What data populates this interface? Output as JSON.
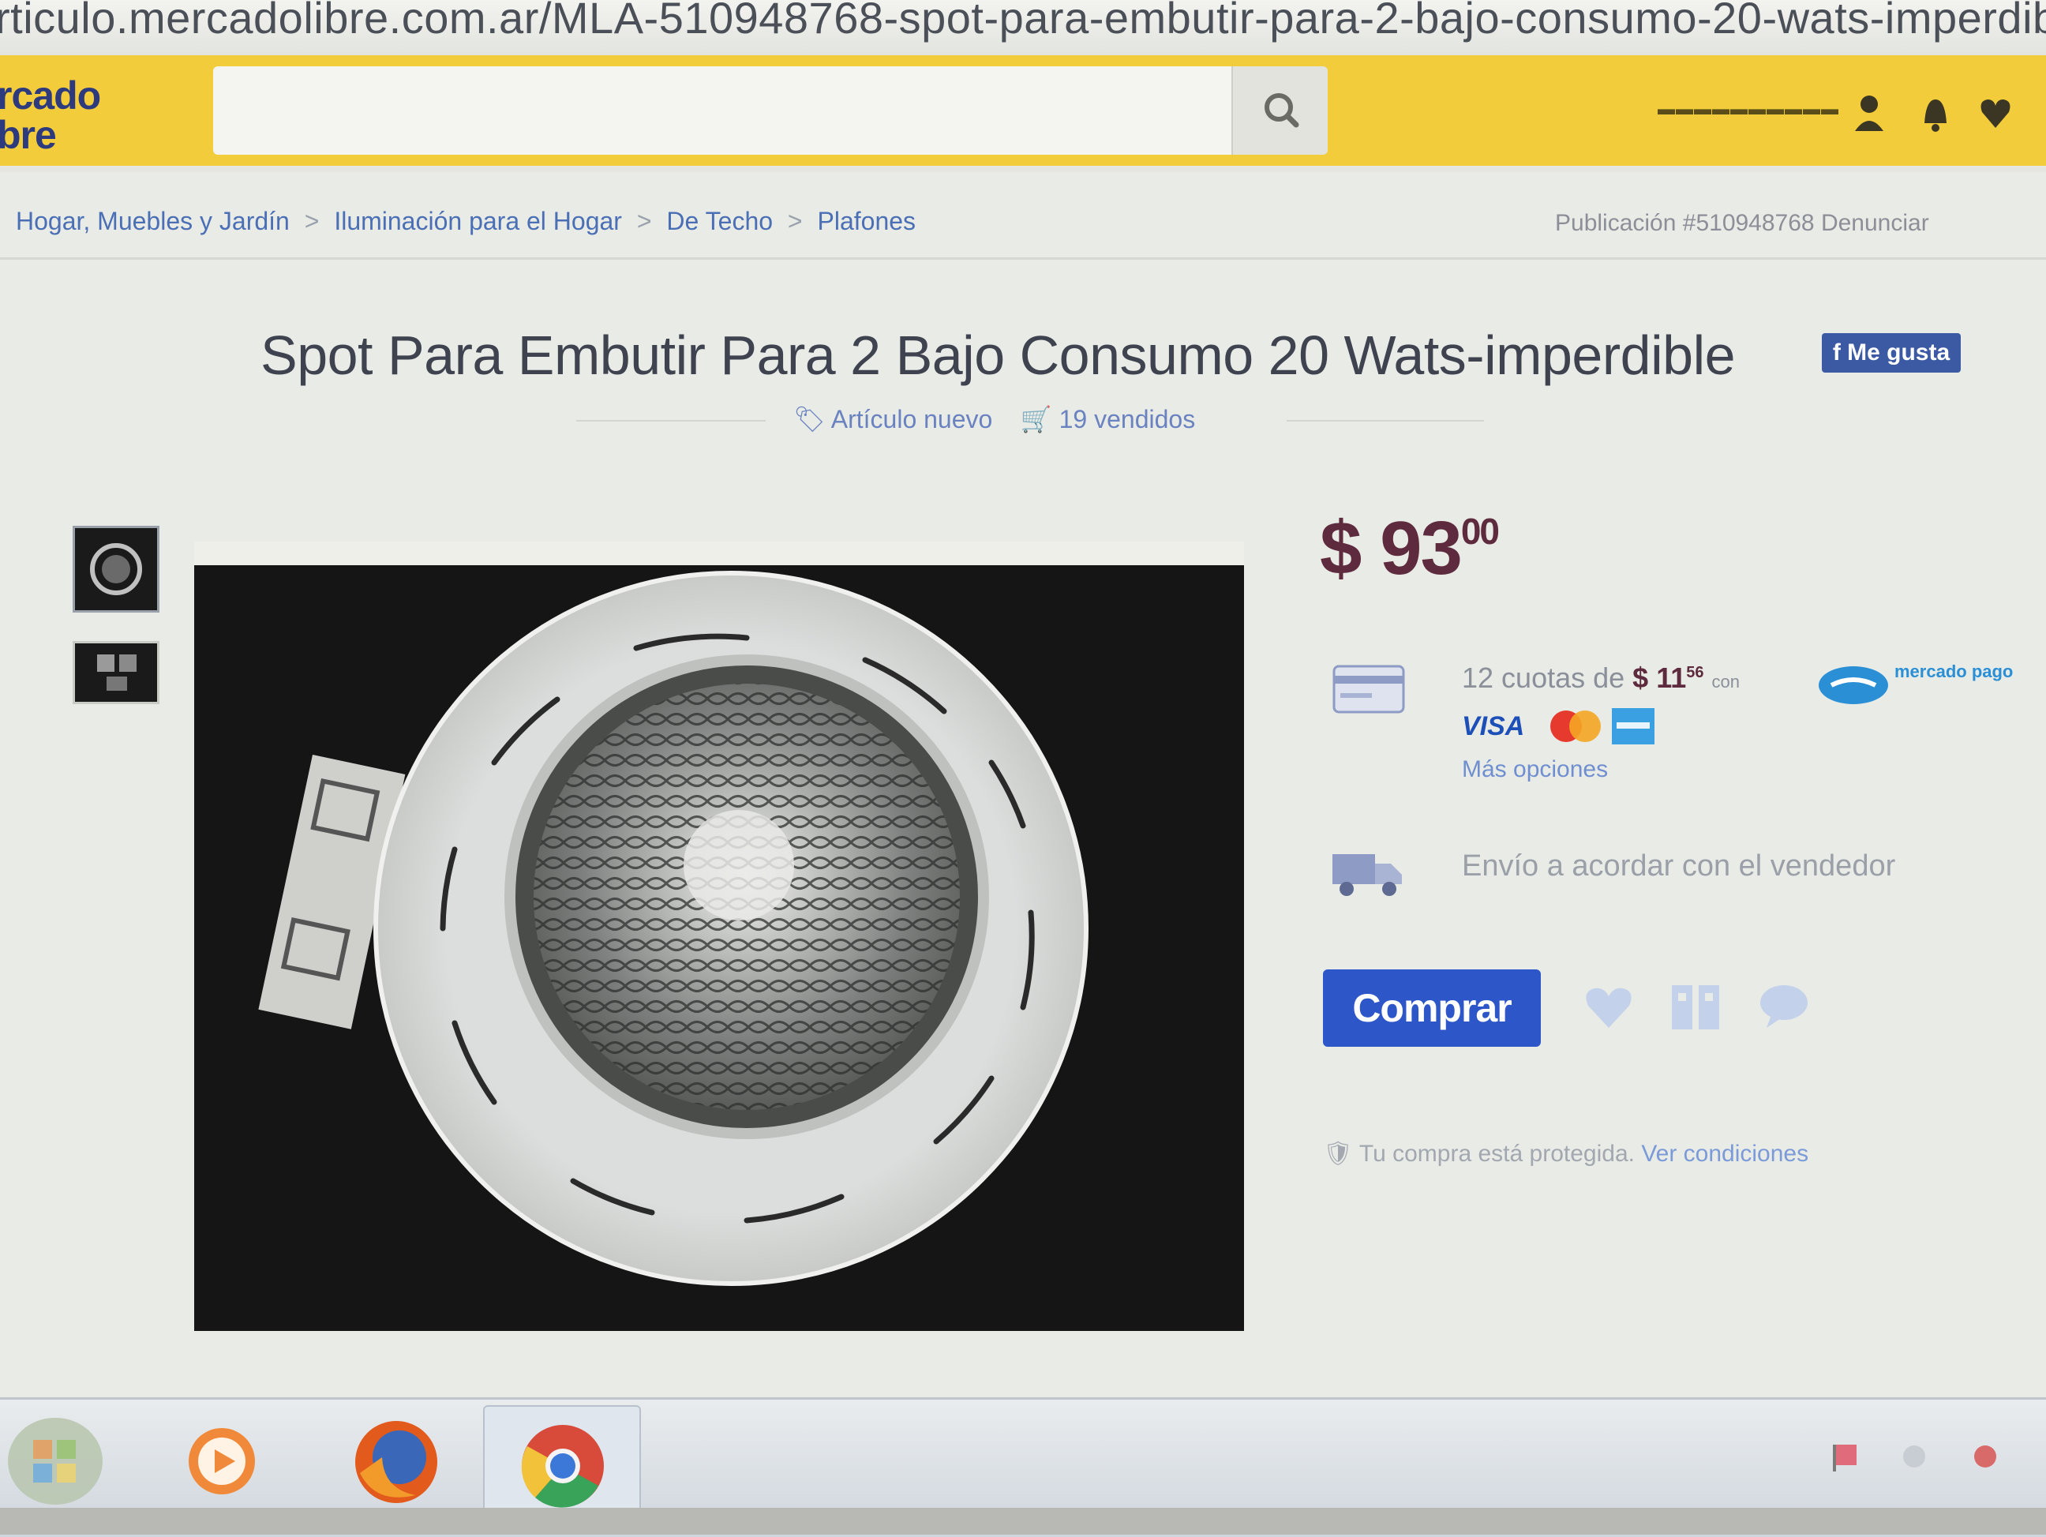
{
  "browser": {
    "url": "rticulo.mercadolibre.com.ar/MLA-510948768-spot-para-embutir-para-2-bajo-consumo-20-wats-imperdib"
  },
  "header": {
    "logo_line1": "rcado",
    "logo_line2": "bre",
    "search_placeholder": "",
    "brand_color": "#f2cc3a"
  },
  "breadcrumb": {
    "items": [
      "Hogar, Muebles y Jardín",
      "Iluminación para el Hogar",
      "De Techo",
      "Plafones"
    ],
    "separator": ">",
    "publication": "Publicación #510948768 Denunciar"
  },
  "product": {
    "title": "Spot Para Embutir Para 2 Bajo Consumo 20 Wats-imperdible",
    "share_label": "f Me gusta",
    "condition": "Artículo nuevo",
    "sold": "19 vendidos",
    "price_main": "$ 93",
    "price_cents": "00"
  },
  "payment": {
    "installments_prefix": "12 cuotas de",
    "installment_amount": "$ 11",
    "installment_cents": "56",
    "installments_suffix": "con",
    "provider": "mercado pago",
    "card_brands": [
      "VISA",
      "Mastercard",
      "American Express"
    ],
    "more_options": "Más opciones"
  },
  "shipping": {
    "text": "Envío a acordar con el vendedor"
  },
  "actions": {
    "buy_label": "Comprar",
    "icons": [
      "heart-icon",
      "share-icon",
      "question-icon"
    ]
  },
  "protection": {
    "text": "Tu compra está protegida.",
    "link": "Ver condiciones"
  },
  "taskbar": {
    "apps": [
      "start-orb-icon",
      "media-player-icon",
      "firefox-icon",
      "chrome-icon"
    ]
  }
}
